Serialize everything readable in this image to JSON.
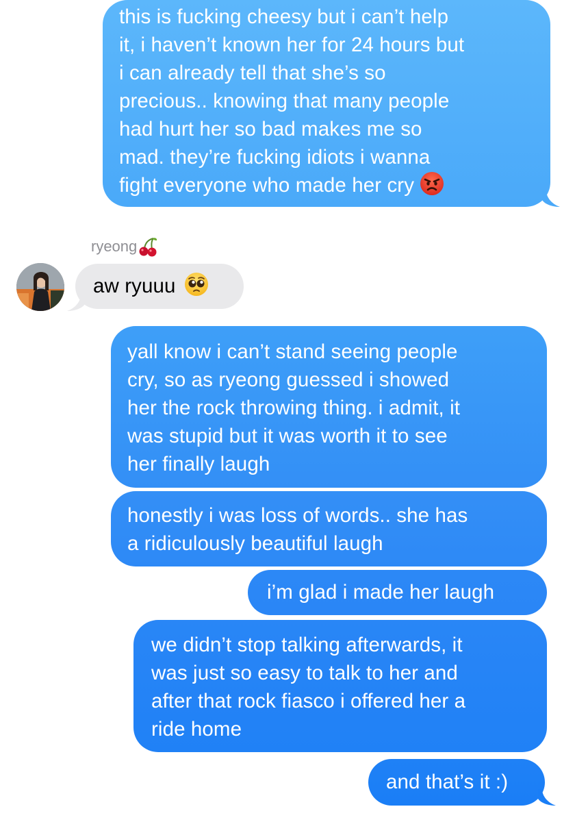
{
  "conversation": {
    "messages": [
      {
        "direction": "outgoing",
        "lines": [
          "this is fucking cheesy but i can’t help",
          "it, i haven’t known her for 24 hours but",
          "i can already tell that she’s so",
          "precious.. knowing that many people",
          "had hurt her so bad makes me so",
          "mad. they’re fucking idiots i wanna",
          "fight everyone who made her cry"
        ],
        "emoji": "angry-face"
      },
      {
        "direction": "incoming",
        "sender": "ryeong",
        "sender_emoji": "cherries",
        "lines": [
          "aw ryuuu"
        ],
        "emoji": "pleading-face"
      },
      {
        "direction": "outgoing",
        "lines": [
          "yall know i can’t stand seeing people",
          "cry, so as ryeong guessed i showed",
          "her the rock throwing thing. i admit, it",
          "was stupid but it was worth it to see",
          "her finally laugh"
        ]
      },
      {
        "direction": "outgoing",
        "lines": [
          "honestly i was loss of words.. she has",
          "a ridiculously beautiful laugh"
        ]
      },
      {
        "direction": "outgoing",
        "lines": [
          "i’m glad i made her laugh"
        ]
      },
      {
        "direction": "outgoing",
        "lines": [
          "we didn’t stop talking afterwards, it",
          "was just so easy to talk to her and",
          "after that rock fiasco i offered her a",
          "ride home"
        ]
      },
      {
        "direction": "outgoing",
        "lines": [
          "and that’s it :)"
        ]
      }
    ]
  },
  "colors": {
    "outgoing_top": "#5bb5fa",
    "outgoing_bottom": "#1a82f7",
    "incoming_bubble": "#e9e9eb",
    "sender_name": "#8e8e93"
  }
}
